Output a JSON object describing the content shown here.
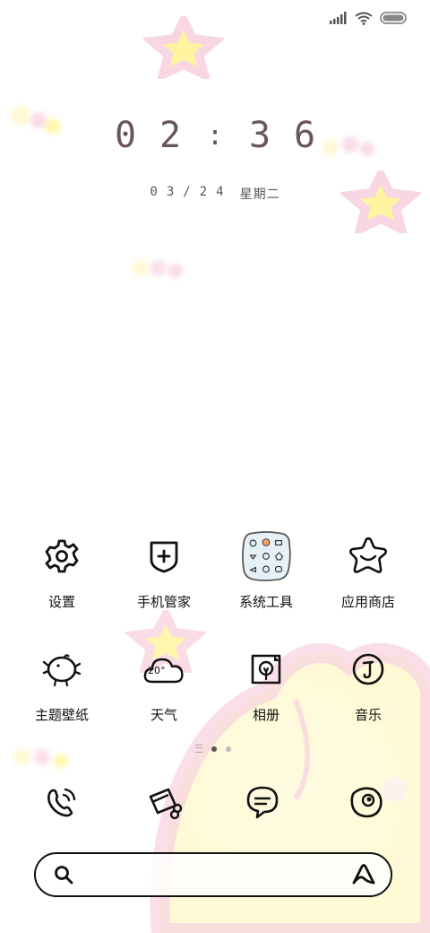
{
  "status_bar": {
    "signal_icon": "signal-bars-icon",
    "wifi_icon": "wifi-icon",
    "battery_icon": "battery-icon"
  },
  "clock": {
    "digits": [
      "0",
      "2",
      ":",
      "3",
      "6"
    ],
    "date": [
      "0",
      "3",
      "/",
      "2",
      "4"
    ],
    "weekday": "星期二"
  },
  "apps_row1": [
    {
      "label": "设置",
      "icon": "gear-icon"
    },
    {
      "label": "手机管家",
      "icon": "shield-plus-icon"
    },
    {
      "label": "系统工具",
      "icon": "folder-icon"
    },
    {
      "label": "应用商店",
      "icon": "smiling-star-icon"
    }
  ],
  "apps_row2": [
    {
      "label": "主题壁纸",
      "icon": "bird-icon"
    },
    {
      "label": "天气",
      "icon": "cloud-icon",
      "badge": "20°"
    },
    {
      "label": "相册",
      "icon": "photo-tree-icon"
    },
    {
      "label": "音乐",
      "icon": "music-note-icon"
    }
  ],
  "dock": [
    {
      "icon": "phone-icon"
    },
    {
      "icon": "cards-icon"
    },
    {
      "icon": "chat-bubble-icon"
    },
    {
      "icon": "camera-icon"
    }
  ],
  "page_indicator": {
    "count": 2,
    "active": 0
  },
  "colors": {
    "accent_pink": "#f6c6d6",
    "accent_yellow": "#fff27a",
    "text": "#111111",
    "clock_text": "#6a5656"
  }
}
